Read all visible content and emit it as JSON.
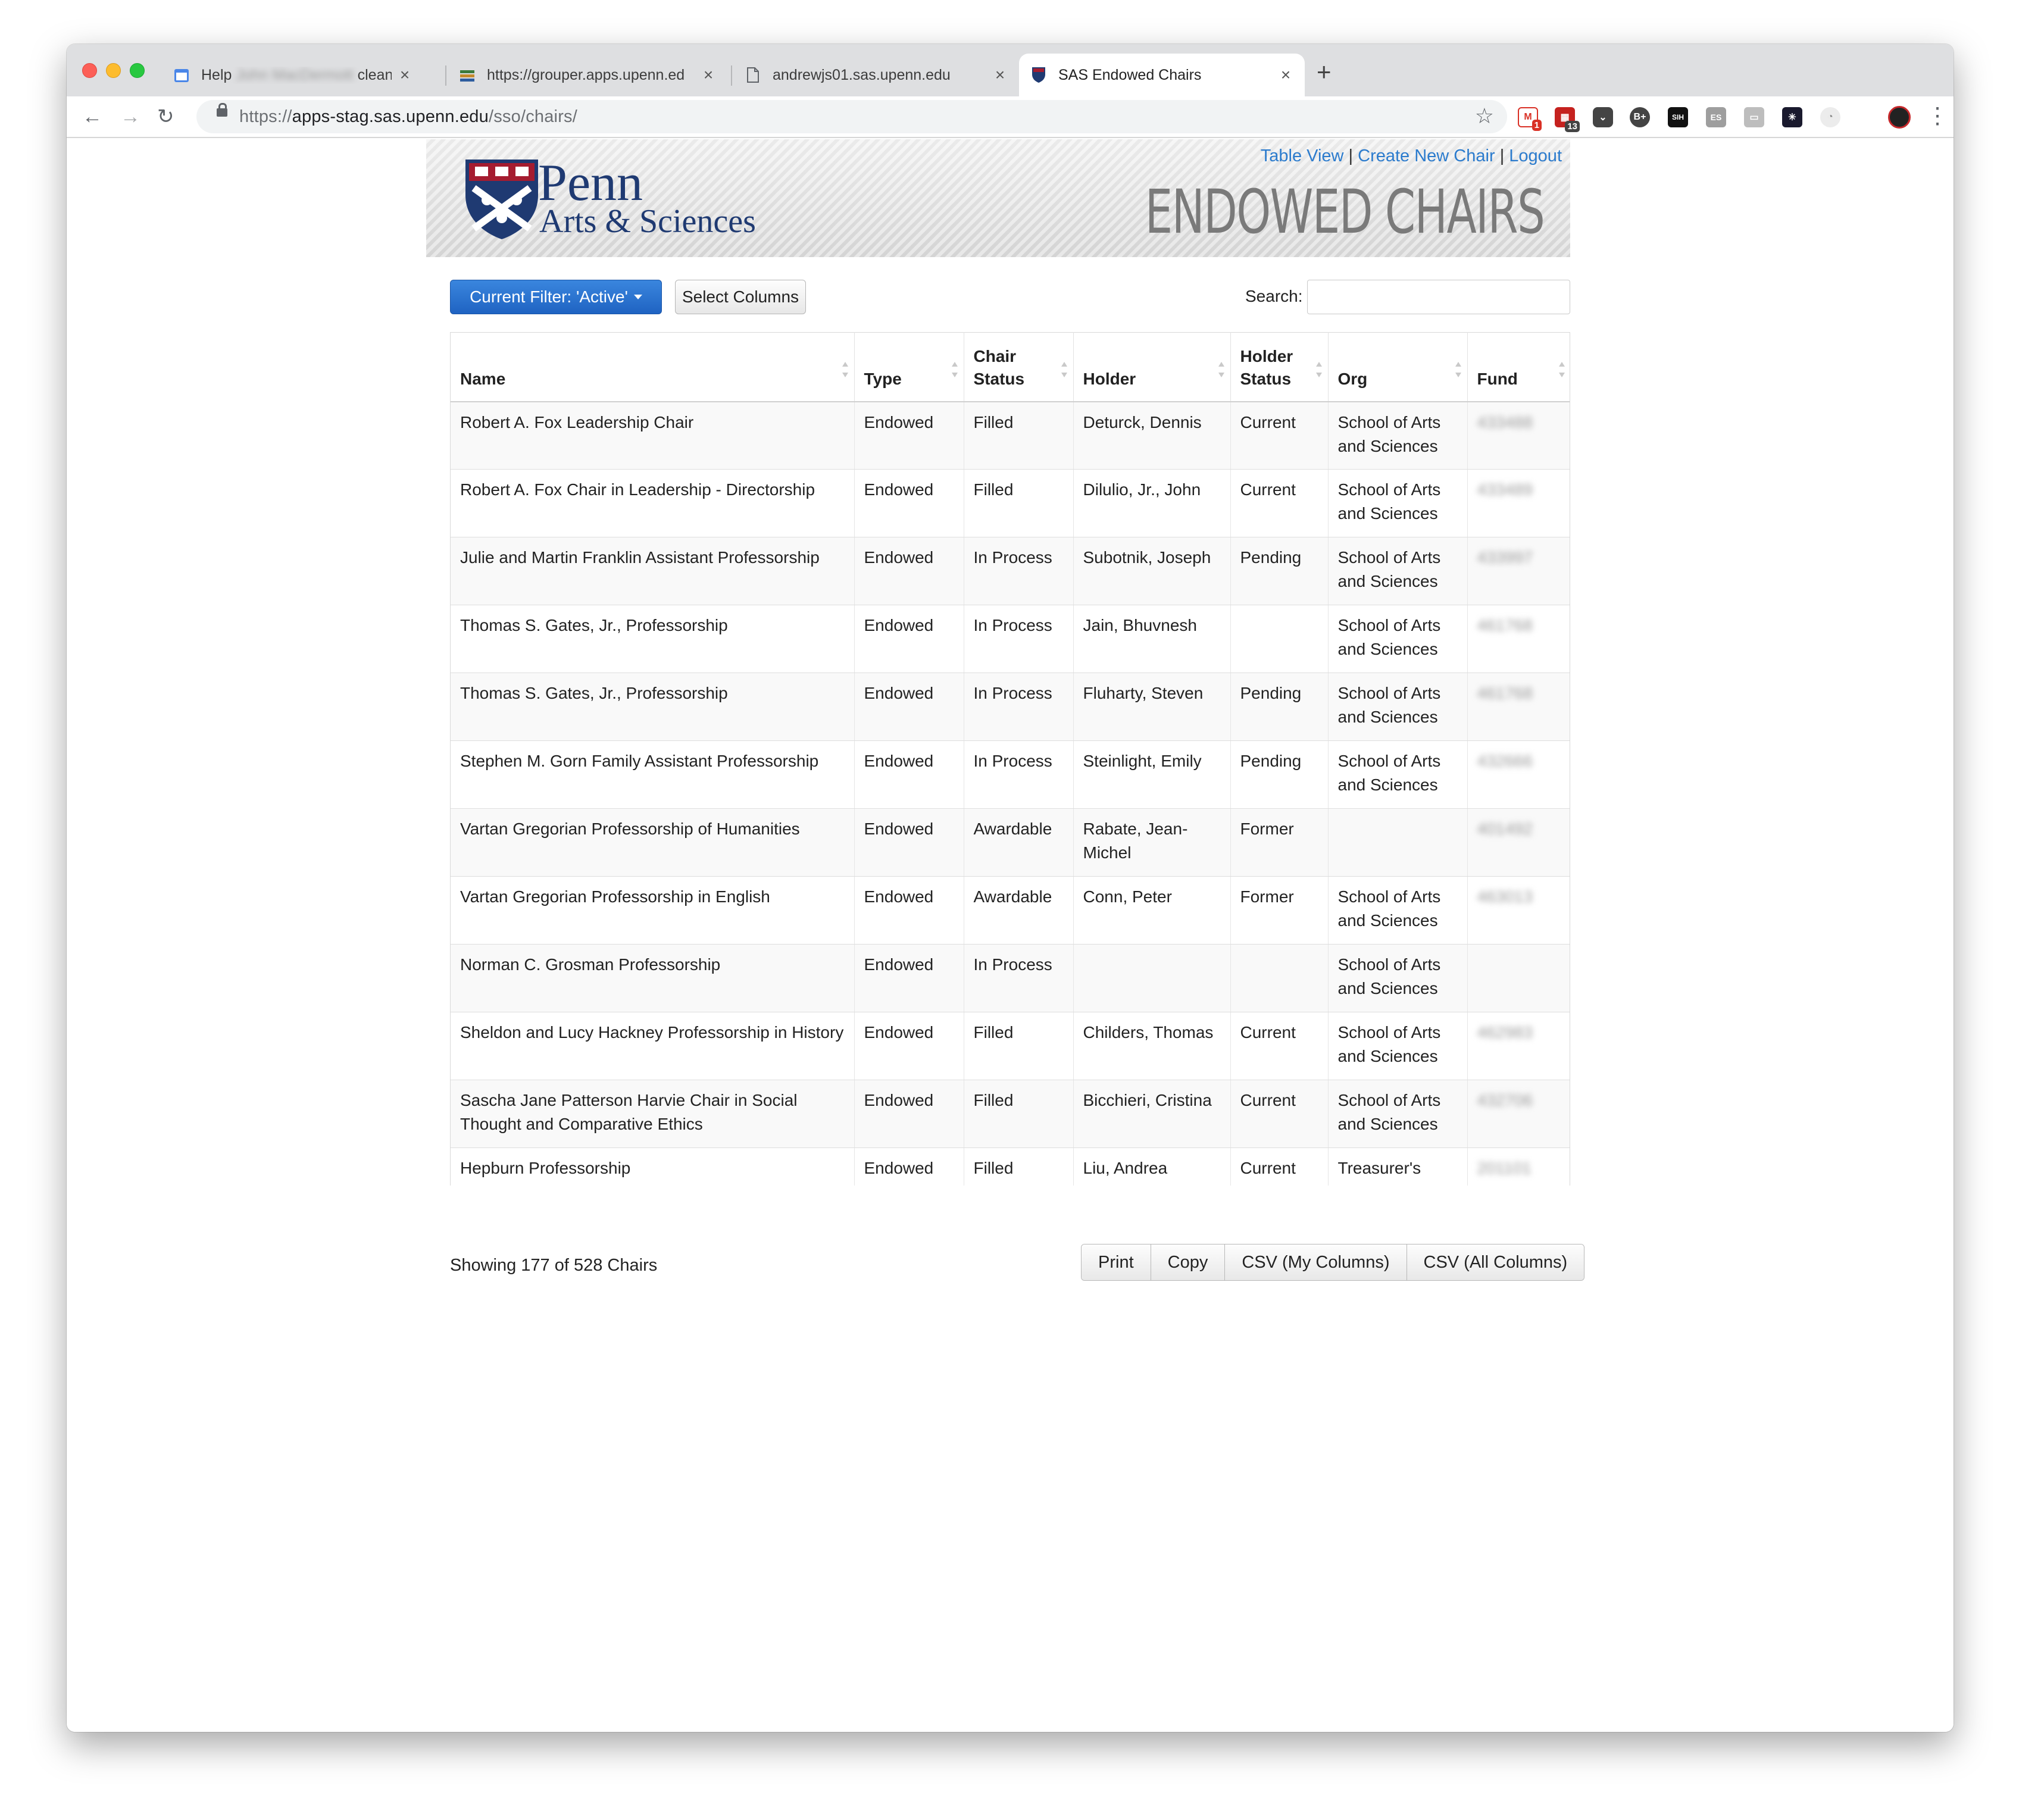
{
  "browser": {
    "tabs": [
      {
        "title": "Help ",
        "blurred": "John MacDermott",
        "suffix": " clean u",
        "icon": "calendar-icon"
      },
      {
        "title": "https://grouper.apps.upenn.ed",
        "icon": "grouper-icon"
      },
      {
        "title": "andrewjs01.sas.upenn.edu",
        "icon": "document-icon"
      },
      {
        "title": "SAS Endowed Chairs",
        "icon": "penn-shield-icon",
        "active": true
      }
    ],
    "new_tab": "+",
    "url_scheme": "https://",
    "url_host": "apps-stag.sas.upenn.edu",
    "url_path": "/sso/chairs/",
    "extensions": [
      {
        "name": "gmail-extension",
        "badge": "1",
        "color": "#d93025"
      },
      {
        "name": "calendar-extension",
        "badge": "13",
        "color": "#c5221f"
      },
      {
        "name": "pocket-extension",
        "badge": "",
        "color": "#444444"
      },
      {
        "name": "bplus-extension",
        "label": "B+",
        "badge": "",
        "color": "#444444"
      },
      {
        "name": "sih-extension",
        "label": "SIH",
        "badge": "",
        "color": "#111111"
      },
      {
        "name": "es-extension",
        "label": "ES",
        "badge": "",
        "color": "#9e9e9e"
      },
      {
        "name": "chat-extension",
        "badge": "",
        "color": "#bdbdbd"
      },
      {
        "name": "burst-extension",
        "badge": "",
        "color": "#1a1a2e"
      },
      {
        "name": "timer-extension",
        "badge": "",
        "color": "#e0e0e0"
      }
    ]
  },
  "header": {
    "logo_penn": "Penn",
    "logo_arts": "Arts & Sciences",
    "nav_table_view": "Table View",
    "nav_sep": "|",
    "nav_create": "Create New Chair",
    "nav_logout": "Logout",
    "title": "ENDOWED CHAIRS"
  },
  "controls": {
    "filter_label": "Current Filter: 'Active'",
    "select_columns_label": "Select Columns",
    "search_label": "Search:",
    "search_value": ""
  },
  "table": {
    "columns": [
      "Name",
      "Type",
      "Chair Status",
      "Holder",
      "Holder Status",
      "Org",
      "Fund"
    ],
    "rows": [
      {
        "name": "Robert A. Fox Leadership Chair",
        "type": "Endowed",
        "chair_status": "Filled",
        "holder": "Deturck, Dennis",
        "holder_status": "Current",
        "org": "School of Arts and Sciences",
        "fund": "433488"
      },
      {
        "name": "Robert A. Fox Chair in Leadership - Directorship",
        "type": "Endowed",
        "chair_status": "Filled",
        "holder": "Dilulio, Jr., John",
        "holder_status": "Current",
        "org": "School of Arts and Sciences",
        "fund": "433489"
      },
      {
        "name": "Julie and Martin Franklin Assistant Professorship",
        "type": "Endowed",
        "chair_status": "In Process",
        "holder": "Subotnik, Joseph",
        "holder_status": "Pending",
        "org": "School of Arts and Sciences",
        "fund": "433997"
      },
      {
        "name": "Thomas S. Gates, Jr., Professorship",
        "type": "Endowed",
        "chair_status": "In Process",
        "holder": "Jain, Bhuvnesh",
        "holder_status": "",
        "org": "School of Arts and Sciences",
        "fund": "461768"
      },
      {
        "name": "Thomas S. Gates, Jr., Professorship",
        "type": "Endowed",
        "chair_status": "In Process",
        "holder": "Fluharty, Steven",
        "holder_status": "Pending",
        "org": "School of Arts and Sciences",
        "fund": "461768"
      },
      {
        "name": "Stephen M. Gorn Family Assistant Professorship",
        "type": "Endowed",
        "chair_status": "In Process",
        "holder": "Steinlight, Emily",
        "holder_status": "Pending",
        "org": "School of Arts and Sciences",
        "fund": "432666"
      },
      {
        "name": "Vartan Gregorian Professorship of Humanities",
        "type": "Endowed",
        "chair_status": "Awardable",
        "holder": "Rabate, Jean-Michel",
        "holder_status": "Former",
        "org": "",
        "fund": "401492"
      },
      {
        "name": "Vartan Gregorian Professorship in English",
        "type": "Endowed",
        "chair_status": "Awardable",
        "holder": "Conn, Peter",
        "holder_status": "Former",
        "org": "School of Arts and Sciences",
        "fund": "463013"
      },
      {
        "name": "Norman C. Grosman Professorship",
        "type": "Endowed",
        "chair_status": "In Process",
        "holder": "",
        "holder_status": "",
        "org": "School of Arts and Sciences",
        "fund": ""
      },
      {
        "name": "Sheldon and Lucy Hackney Professorship in History",
        "type": "Endowed",
        "chair_status": "Filled",
        "holder": "Childers, Thomas",
        "holder_status": "Current",
        "org": "School of Arts and Sciences",
        "fund": "462983"
      },
      {
        "name": "Sascha Jane Patterson Harvie Chair in Social Thought and Comparative Ethics",
        "type": "Endowed",
        "chair_status": "Filled",
        "holder": "Bicchieri, Cristina",
        "holder_status": "Current",
        "org": "School of Arts and Sciences",
        "fund": "432706"
      },
      {
        "name": "Hepburn Professorship",
        "type": "Endowed",
        "chair_status": "Filled",
        "holder": "Liu, Andrea",
        "holder_status": "Current",
        "org": "Treasurer's",
        "fund": "201101"
      }
    ]
  },
  "footer": {
    "info": "Showing 177 of 528 Chairs",
    "buttons": [
      "Print",
      "Copy",
      "CSV (My Columns)",
      "CSV (All Columns)"
    ]
  }
}
